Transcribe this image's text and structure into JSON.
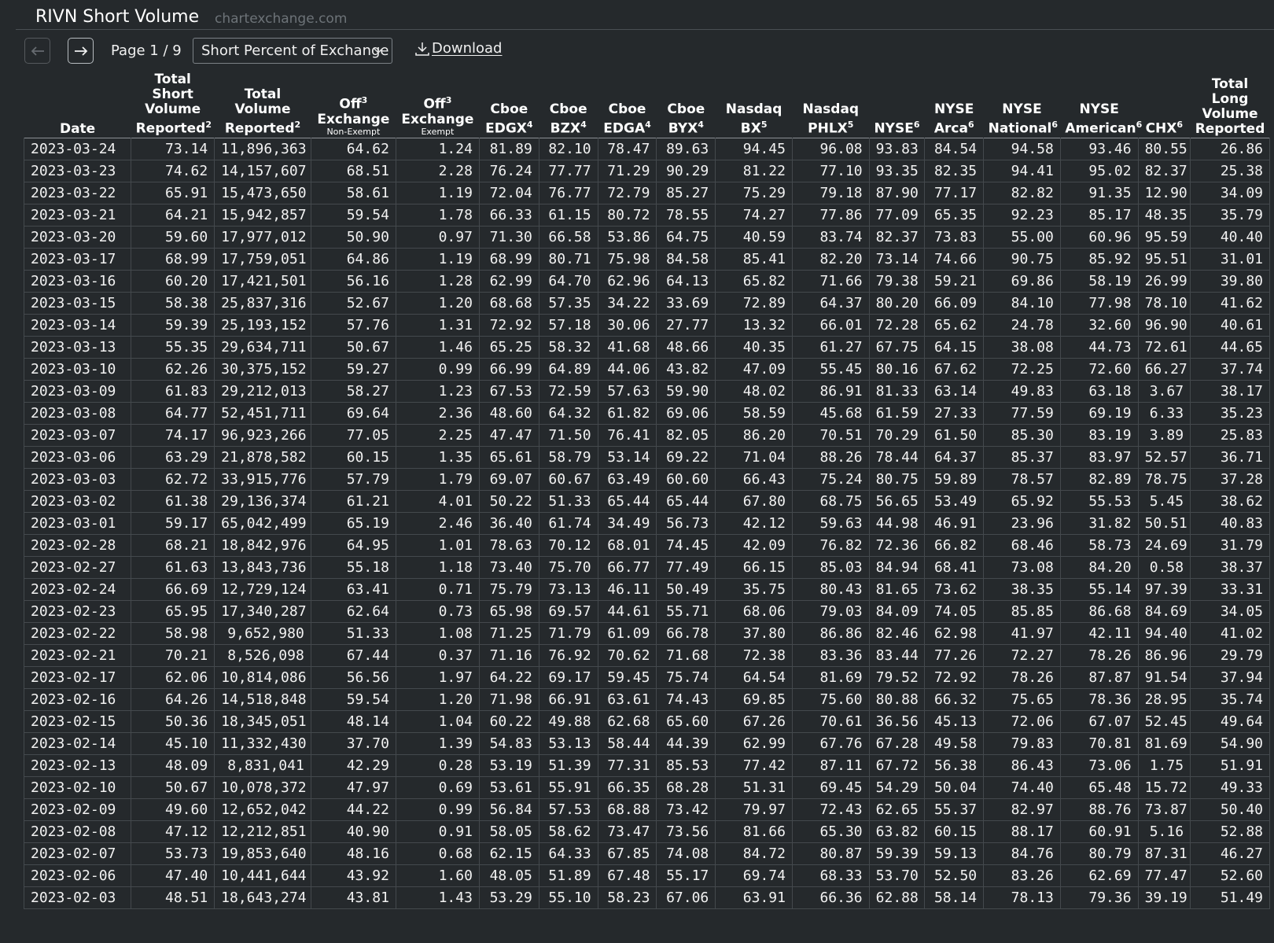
{
  "header": {
    "title": "RIVN Short Volume",
    "subtitle": "chartexchange.com"
  },
  "toolbar": {
    "prev_icon": "arrow-left-icon",
    "next_icon": "arrow-right-icon",
    "page_label": "Page 1 / 9",
    "select_value": "Short Percent of Exchange",
    "download_label": "Download"
  },
  "table": {
    "headers": [
      {
        "lines": [
          "Date"
        ],
        "sup": "",
        "small": ""
      },
      {
        "lines": [
          "Total",
          "Short",
          "Volume",
          "Reported"
        ],
        "sup": "2",
        "small": ""
      },
      {
        "lines": [
          "Total",
          "Volume",
          "Reported"
        ],
        "sup": "2",
        "small": ""
      },
      {
        "lines": [
          "Off",
          "Exchange"
        ],
        "sup": "3",
        "small": "Non-Exempt"
      },
      {
        "lines": [
          "Off",
          "Exchange"
        ],
        "sup": "3",
        "small": "Exempt"
      },
      {
        "lines": [
          "Cboe",
          "EDGX"
        ],
        "sup": "4",
        "small": ""
      },
      {
        "lines": [
          "Cboe",
          "BZX"
        ],
        "sup": "4",
        "small": ""
      },
      {
        "lines": [
          "Cboe",
          "EDGA"
        ],
        "sup": "4",
        "small": ""
      },
      {
        "lines": [
          "Cboe",
          "BYX"
        ],
        "sup": "4",
        "small": ""
      },
      {
        "lines": [
          "Nasdaq",
          "BX"
        ],
        "sup": "5",
        "small": ""
      },
      {
        "lines": [
          "Nasdaq",
          "PHLX"
        ],
        "sup": "5",
        "small": ""
      },
      {
        "lines": [
          "NYSE"
        ],
        "sup": "6",
        "small": ""
      },
      {
        "lines": [
          "NYSE",
          "Arca"
        ],
        "sup": "6",
        "small": ""
      },
      {
        "lines": [
          "NYSE",
          "National"
        ],
        "sup": "6",
        "small": ""
      },
      {
        "lines": [
          "NYSE",
          "American"
        ],
        "sup": "6",
        "small": ""
      },
      {
        "lines": [
          "CHX"
        ],
        "sup": "6",
        "small": ""
      },
      {
        "lines": [
          "Total",
          "Long",
          "Volume",
          "Reported"
        ],
        "sup": "",
        "small": ""
      }
    ],
    "rows": [
      [
        "2023-03-24",
        "73.14",
        "11,896,363",
        "64.62",
        "1.24",
        "81.89",
        "82.10",
        "78.47",
        "89.63",
        "94.45",
        "96.08",
        "93.83",
        "84.54",
        "94.58",
        "93.46",
        "80.55",
        "26.86"
      ],
      [
        "2023-03-23",
        "74.62",
        "14,157,607",
        "68.51",
        "2.28",
        "76.24",
        "77.77",
        "71.29",
        "90.29",
        "81.22",
        "77.10",
        "93.35",
        "82.35",
        "94.41",
        "95.02",
        "82.37",
        "25.38"
      ],
      [
        "2023-03-22",
        "65.91",
        "15,473,650",
        "58.61",
        "1.19",
        "72.04",
        "76.77",
        "72.79",
        "85.27",
        "75.29",
        "79.18",
        "87.90",
        "77.17",
        "82.82",
        "91.35",
        "12.90",
        "34.09"
      ],
      [
        "2023-03-21",
        "64.21",
        "15,942,857",
        "59.54",
        "1.78",
        "66.33",
        "61.15",
        "80.72",
        "78.55",
        "74.27",
        "77.86",
        "77.09",
        "65.35",
        "92.23",
        "85.17",
        "48.35",
        "35.79"
      ],
      [
        "2023-03-20",
        "59.60",
        "17,977,012",
        "50.90",
        "0.97",
        "71.30",
        "66.58",
        "53.86",
        "64.75",
        "40.59",
        "83.74",
        "82.37",
        "73.83",
        "55.00",
        "60.96",
        "95.59",
        "40.40"
      ],
      [
        "2023-03-17",
        "68.99",
        "17,759,051",
        "64.86",
        "1.19",
        "68.99",
        "80.71",
        "75.98",
        "84.58",
        "85.41",
        "82.20",
        "73.14",
        "74.66",
        "90.75",
        "85.92",
        "95.51",
        "31.01"
      ],
      [
        "2023-03-16",
        "60.20",
        "17,421,501",
        "56.16",
        "1.28",
        "62.99",
        "64.70",
        "62.96",
        "64.13",
        "65.82",
        "71.66",
        "79.38",
        "59.21",
        "69.86",
        "58.19",
        "26.99",
        "39.80"
      ],
      [
        "2023-03-15",
        "58.38",
        "25,837,316",
        "52.67",
        "1.20",
        "68.68",
        "57.35",
        "34.22",
        "33.69",
        "72.89",
        "64.37",
        "80.20",
        "66.09",
        "84.10",
        "77.98",
        "78.10",
        "41.62"
      ],
      [
        "2023-03-14",
        "59.39",
        "25,193,152",
        "57.76",
        "1.31",
        "72.92",
        "57.18",
        "30.06",
        "27.77",
        "13.32",
        "66.01",
        "72.28",
        "65.62",
        "24.78",
        "32.60",
        "96.90",
        "40.61"
      ],
      [
        "2023-03-13",
        "55.35",
        "29,634,711",
        "50.67",
        "1.46",
        "65.25",
        "58.32",
        "41.68",
        "48.66",
        "40.35",
        "61.27",
        "67.75",
        "64.15",
        "38.08",
        "44.73",
        "72.61",
        "44.65"
      ],
      [
        "2023-03-10",
        "62.26",
        "30,375,152",
        "59.27",
        "0.99",
        "66.99",
        "64.89",
        "44.06",
        "43.82",
        "47.09",
        "55.45",
        "80.16",
        "67.62",
        "72.25",
        "72.60",
        "66.27",
        "37.74"
      ],
      [
        "2023-03-09",
        "61.83",
        "29,212,013",
        "58.27",
        "1.23",
        "67.53",
        "72.59",
        "57.63",
        "59.90",
        "48.02",
        "86.91",
        "81.33",
        "63.14",
        "49.83",
        "63.18",
        "3.67",
        "38.17"
      ],
      [
        "2023-03-08",
        "64.77",
        "52,451,711",
        "69.64",
        "2.36",
        "48.60",
        "64.32",
        "61.82",
        "69.06",
        "58.59",
        "45.68",
        "61.59",
        "27.33",
        "77.59",
        "69.19",
        "6.33",
        "35.23"
      ],
      [
        "2023-03-07",
        "74.17",
        "96,923,266",
        "77.05",
        "2.25",
        "47.47",
        "71.50",
        "76.41",
        "82.05",
        "86.20",
        "70.51",
        "70.29",
        "61.50",
        "85.30",
        "83.19",
        "3.89",
        "25.83"
      ],
      [
        "2023-03-06",
        "63.29",
        "21,878,582",
        "60.15",
        "1.35",
        "65.61",
        "58.79",
        "53.14",
        "69.22",
        "71.04",
        "88.26",
        "78.44",
        "64.37",
        "85.37",
        "83.97",
        "52.57",
        "36.71"
      ],
      [
        "2023-03-03",
        "62.72",
        "33,915,776",
        "57.79",
        "1.79",
        "69.07",
        "60.67",
        "63.49",
        "60.60",
        "66.43",
        "75.24",
        "80.75",
        "59.89",
        "78.57",
        "82.89",
        "78.75",
        "37.28"
      ],
      [
        "2023-03-02",
        "61.38",
        "29,136,374",
        "61.21",
        "4.01",
        "50.22",
        "51.33",
        "65.44",
        "65.44",
        "67.80",
        "68.75",
        "56.65",
        "53.49",
        "65.92",
        "55.53",
        "5.45",
        "38.62"
      ],
      [
        "2023-03-01",
        "59.17",
        "65,042,499",
        "65.19",
        "2.46",
        "36.40",
        "61.74",
        "34.49",
        "56.73",
        "42.12",
        "59.63",
        "44.98",
        "46.91",
        "23.96",
        "31.82",
        "50.51",
        "40.83"
      ],
      [
        "2023-02-28",
        "68.21",
        "18,842,976",
        "64.95",
        "1.01",
        "78.63",
        "70.12",
        "68.01",
        "74.45",
        "42.09",
        "76.82",
        "72.36",
        "66.82",
        "68.46",
        "58.73",
        "24.69",
        "31.79"
      ],
      [
        "2023-02-27",
        "61.63",
        "13,843,736",
        "55.18",
        "1.18",
        "73.40",
        "75.70",
        "66.77",
        "77.49",
        "66.15",
        "85.03",
        "84.94",
        "68.41",
        "73.08",
        "84.20",
        "0.58",
        "38.37"
      ],
      [
        "2023-02-24",
        "66.69",
        "12,729,124",
        "63.41",
        "0.71",
        "75.79",
        "73.13",
        "46.11",
        "50.49",
        "35.75",
        "80.43",
        "81.65",
        "73.62",
        "38.35",
        "55.14",
        "97.39",
        "33.31"
      ],
      [
        "2023-02-23",
        "65.95",
        "17,340,287",
        "62.64",
        "0.73",
        "65.98",
        "69.57",
        "44.61",
        "55.71",
        "68.06",
        "79.03",
        "84.09",
        "74.05",
        "85.85",
        "86.68",
        "84.69",
        "34.05"
      ],
      [
        "2023-02-22",
        "58.98",
        "9,652,980",
        "51.33",
        "1.08",
        "71.25",
        "71.79",
        "61.09",
        "66.78",
        "37.80",
        "86.86",
        "82.46",
        "62.98",
        "41.97",
        "42.11",
        "94.40",
        "41.02"
      ],
      [
        "2023-02-21",
        "70.21",
        "8,526,098",
        "67.44",
        "0.37",
        "71.16",
        "76.92",
        "70.62",
        "71.68",
        "72.38",
        "83.36",
        "83.44",
        "77.26",
        "72.27",
        "78.26",
        "86.96",
        "29.79"
      ],
      [
        "2023-02-17",
        "62.06",
        "10,814,086",
        "56.56",
        "1.97",
        "64.22",
        "69.17",
        "59.45",
        "75.74",
        "64.54",
        "81.69",
        "79.52",
        "72.92",
        "78.26",
        "87.87",
        "91.54",
        "37.94"
      ],
      [
        "2023-02-16",
        "64.26",
        "14,518,848",
        "59.54",
        "1.20",
        "71.98",
        "66.91",
        "63.61",
        "74.43",
        "69.85",
        "75.60",
        "80.88",
        "66.32",
        "75.65",
        "78.36",
        "28.95",
        "35.74"
      ],
      [
        "2023-02-15",
        "50.36",
        "18,345,051",
        "48.14",
        "1.04",
        "60.22",
        "49.88",
        "62.68",
        "65.60",
        "67.26",
        "70.61",
        "36.56",
        "45.13",
        "72.06",
        "67.07",
        "52.45",
        "49.64"
      ],
      [
        "2023-02-14",
        "45.10",
        "11,332,430",
        "37.70",
        "1.39",
        "54.83",
        "53.13",
        "58.44",
        "44.39",
        "62.99",
        "67.76",
        "67.28",
        "49.58",
        "79.83",
        "70.81",
        "81.69",
        "54.90"
      ],
      [
        "2023-02-13",
        "48.09",
        "8,831,041",
        "42.29",
        "0.28",
        "53.19",
        "51.39",
        "77.31",
        "85.53",
        "77.42",
        "87.11",
        "67.72",
        "56.38",
        "86.43",
        "73.06",
        "1.75",
        "51.91"
      ],
      [
        "2023-02-10",
        "50.67",
        "10,078,372",
        "47.97",
        "0.69",
        "53.61",
        "55.91",
        "66.35",
        "68.28",
        "51.31",
        "69.45",
        "54.29",
        "50.04",
        "74.40",
        "65.48",
        "15.72",
        "49.33"
      ],
      [
        "2023-02-09",
        "49.60",
        "12,652,042",
        "44.22",
        "0.99",
        "56.84",
        "57.53",
        "68.88",
        "73.42",
        "79.97",
        "72.43",
        "62.65",
        "55.37",
        "82.97",
        "88.76",
        "73.87",
        "50.40"
      ],
      [
        "2023-02-08",
        "47.12",
        "12,212,851",
        "40.90",
        "0.91",
        "58.05",
        "58.62",
        "73.47",
        "73.56",
        "81.66",
        "65.30",
        "63.82",
        "60.15",
        "88.17",
        "60.91",
        "5.16",
        "52.88"
      ],
      [
        "2023-02-07",
        "53.73",
        "19,853,640",
        "48.16",
        "0.68",
        "62.15",
        "64.33",
        "67.85",
        "74.08",
        "84.72",
        "80.87",
        "59.39",
        "59.13",
        "84.76",
        "80.79",
        "87.31",
        "46.27"
      ],
      [
        "2023-02-06",
        "47.40",
        "10,441,644",
        "43.92",
        "1.60",
        "48.05",
        "51.89",
        "67.48",
        "55.17",
        "69.74",
        "68.33",
        "53.70",
        "52.50",
        "83.26",
        "62.69",
        "77.47",
        "52.60"
      ],
      [
        "2023-02-03",
        "48.51",
        "18,643,274",
        "43.81",
        "1.43",
        "53.29",
        "55.10",
        "58.23",
        "67.06",
        "63.91",
        "66.36",
        "62.88",
        "58.14",
        "78.13",
        "79.36",
        "39.19",
        "51.49"
      ]
    ]
  }
}
